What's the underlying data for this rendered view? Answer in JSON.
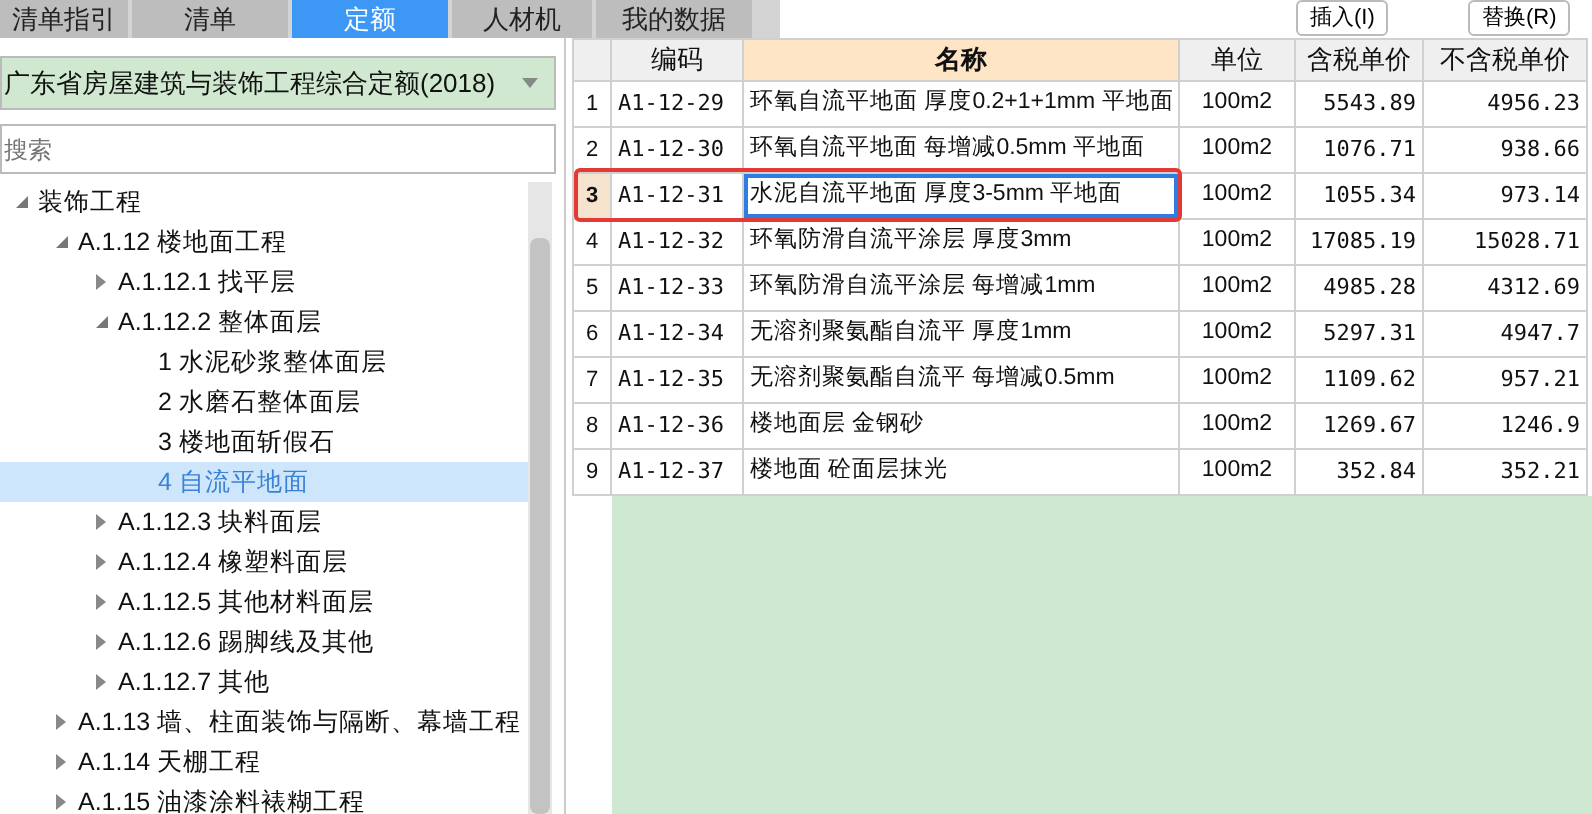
{
  "tabs": [
    {
      "label": "清单指引",
      "selected": false
    },
    {
      "label": "清单",
      "selected": false
    },
    {
      "label": "定额",
      "selected": true
    },
    {
      "label": "人材机",
      "selected": false
    },
    {
      "label": "我的数据",
      "selected": false
    }
  ],
  "buttons": [
    "插入(I)",
    "替换(R)"
  ],
  "library_select": {
    "value": "广东省房屋建筑与装饰工程综合定额(2018)"
  },
  "search": {
    "placeholder": "搜索"
  },
  "tree": [
    {
      "label": "装饰工程",
      "expanded": true,
      "selected": false,
      "children": [
        {
          "label": "A.1.12 楼地面工程",
          "expanded": true,
          "selected": false,
          "children": [
            {
              "label": "A.1.12.1 找平层",
              "expanded": false,
              "selected": false
            },
            {
              "label": "A.1.12.2 整体面层",
              "expanded": true,
              "selected": false,
              "children": [
                {
                  "label": "1 水泥砂浆整体面层",
                  "selected": false
                },
                {
                  "label": "2 水磨石整体面层",
                  "selected": false
                },
                {
                  "label": "3 楼地面斩假石",
                  "selected": false
                },
                {
                  "label": "4 自流平地面",
                  "selected": true
                }
              ]
            },
            {
              "label": "A.1.12.3 块料面层",
              "expanded": false,
              "selected": false
            },
            {
              "label": "A.1.12.4 橡塑料面层",
              "expanded": false,
              "selected": false
            },
            {
              "label": "A.1.12.5 其他材料面层",
              "expanded": false,
              "selected": false
            },
            {
              "label": "A.1.12.6 踢脚线及其他",
              "expanded": false,
              "selected": false
            },
            {
              "label": "A.1.12.7 其他",
              "expanded": false,
              "selected": false
            }
          ]
        },
        {
          "label": "A.1.13 墙、柱面装饰与隔断、幕墙工程",
          "expanded": false,
          "selected": false
        },
        {
          "label": "A.1.14 天棚工程",
          "expanded": false,
          "selected": false
        },
        {
          "label": "A.1.15 油漆涂料裱糊工程",
          "expanded": false,
          "selected": false
        }
      ]
    }
  ],
  "table": {
    "columns": [
      "编码",
      "名称",
      "单位",
      "含税单价",
      "不含税单价"
    ],
    "rows": [
      {
        "index": "1",
        "cells": [
          "A1-12-29",
          "环氧自流平地面 厚度0.2+1+1mm 平地面",
          "100m2",
          "5543.89",
          "4956.23"
        ],
        "selected": false
      },
      {
        "index": "2",
        "cells": [
          "A1-12-30",
          "环氧自流平地面 每增减0.5mm 平地面",
          "100m2",
          "1076.71",
          "938.66"
        ],
        "selected": false
      },
      {
        "index": "3",
        "cells": [
          "A1-12-31",
          "水泥自流平地面 厚度3-5mm 平地面",
          "100m2",
          "1055.34",
          "973.14"
        ],
        "selected": true
      },
      {
        "index": "4",
        "cells": [
          "A1-12-32",
          "环氧防滑自流平涂层 厚度3mm",
          "100m2",
          "17085.19",
          "15028.71"
        ],
        "selected": false
      },
      {
        "index": "5",
        "cells": [
          "A1-12-33",
          "环氧防滑自流平涂层 每增减1mm",
          "100m2",
          "4985.28",
          "4312.69"
        ],
        "selected": false
      },
      {
        "index": "6",
        "cells": [
          "A1-12-34",
          "无溶剂聚氨酯自流平 厚度1mm",
          "100m2",
          "5297.31",
          "4947.7"
        ],
        "selected": false
      },
      {
        "index": "7",
        "cells": [
          "A1-12-35",
          "无溶剂聚氨酯自流平 每增减0.5mm",
          "100m2",
          "1109.62",
          "957.21"
        ],
        "selected": false
      },
      {
        "index": "8",
        "cells": [
          "A1-12-36",
          "楼地面层 金钢砂",
          "100m2",
          "1269.67",
          "1246.9"
        ],
        "selected": false
      },
      {
        "index": "9",
        "cells": [
          "A1-12-37",
          "楼地面 砼面层抹光",
          "100m2",
          "352.84",
          "352.21"
        ],
        "selected": false
      }
    ]
  }
}
